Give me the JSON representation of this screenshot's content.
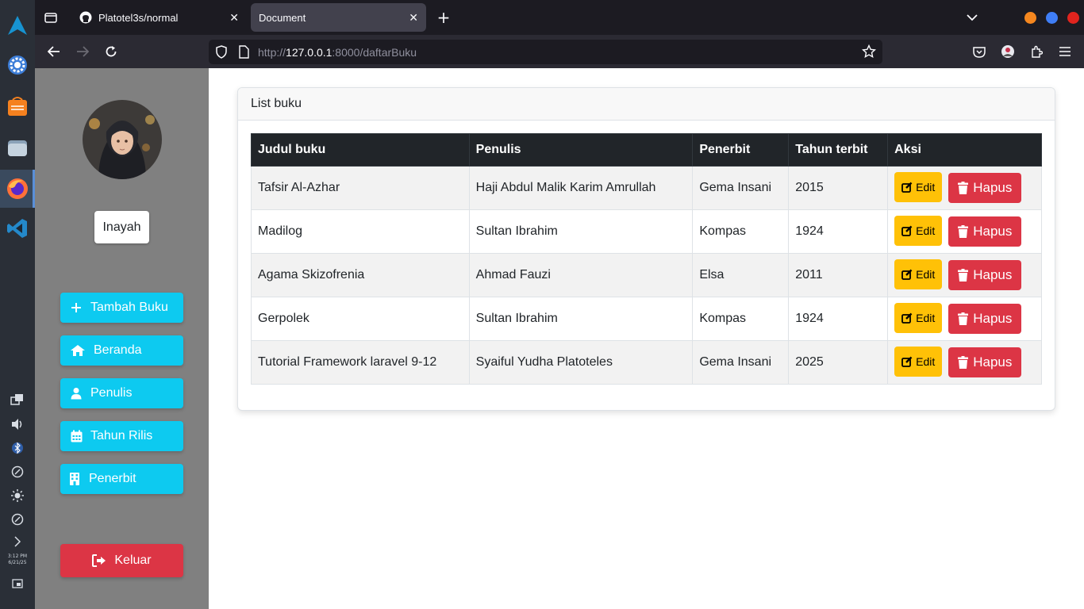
{
  "os": {
    "clock_time": "3:12 PM",
    "clock_date": "6/21/25"
  },
  "browser": {
    "tabs": [
      {
        "label": "Platotel3s/normal",
        "active": false
      },
      {
        "label": "Document",
        "active": true
      }
    ],
    "url_prefix": "http://",
    "url_host": "127.0.0.1",
    "url_rest": ":8000/daftarBuku"
  },
  "sidebar": {
    "username": "Inayah",
    "nav": [
      {
        "label": "Tambah Buku",
        "icon": "plus-icon"
      },
      {
        "label": "Beranda",
        "icon": "home-icon"
      },
      {
        "label": "Penulis",
        "icon": "user-icon"
      },
      {
        "label": "Tahun Rilis",
        "icon": "calendar-icon"
      },
      {
        "label": "Penerbit",
        "icon": "building-icon"
      }
    ],
    "logout_label": "Keluar"
  },
  "colors": {
    "sidebar_bg": "#808080",
    "nav_button": "#0dcaf0",
    "logout_button": "#dc3545",
    "edit_button": "#ffc107",
    "delete_button": "#dc3545",
    "table_header": "#212529"
  },
  "main": {
    "card_title": "List buku",
    "table": {
      "headers": [
        "Judul buku",
        "Penulis",
        "Penerbit",
        "Tahun terbit",
        "Aksi"
      ],
      "rows": [
        {
          "judul": "Tafsir Al-Azhar",
          "penulis": "Haji Abdul Malik Karim Amrullah",
          "penerbit": "Gema Insani",
          "tahun": "2015"
        },
        {
          "judul": "Madilog",
          "penulis": "Sultan Ibrahim",
          "penerbit": "Kompas",
          "tahun": "1924"
        },
        {
          "judul": "Agama Skizofrenia",
          "penulis": "Ahmad Fauzi",
          "penerbit": "Elsa",
          "tahun": "2011"
        },
        {
          "judul": "Gerpolek",
          "penulis": "Sultan Ibrahim",
          "penerbit": "Kompas",
          "tahun": "1924"
        },
        {
          "judul": "Tutorial Framework laravel 9-12",
          "penulis": "Syaiful Yudha Platoteles",
          "penerbit": "Gema Insani",
          "tahun": "2025"
        }
      ],
      "edit_label": "Edit",
      "delete_label": "Hapus"
    }
  }
}
